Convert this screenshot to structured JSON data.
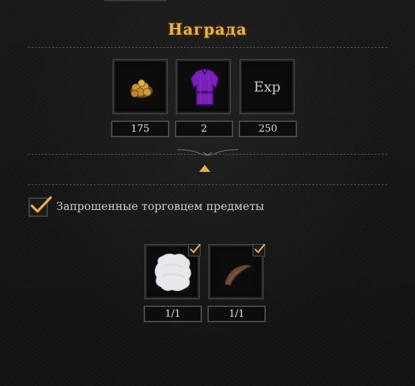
{
  "reward": {
    "title": "Награда",
    "items": [
      {
        "name": "gold-coins",
        "count": "175"
      },
      {
        "name": "purple-tunic",
        "count": "2"
      },
      {
        "name": "exp",
        "label": "Exp",
        "count": "250"
      }
    ]
  },
  "requested": {
    "label": "Запрошенные торговцем предметы",
    "checked": true,
    "items": [
      {
        "name": "white-fur",
        "count": "1/1",
        "checked": true
      },
      {
        "name": "horn",
        "count": "1/1",
        "checked": true
      }
    ]
  },
  "colors": {
    "title": "#f0b429",
    "check": "#e8b23a",
    "tunic": "#7a1fb8"
  }
}
